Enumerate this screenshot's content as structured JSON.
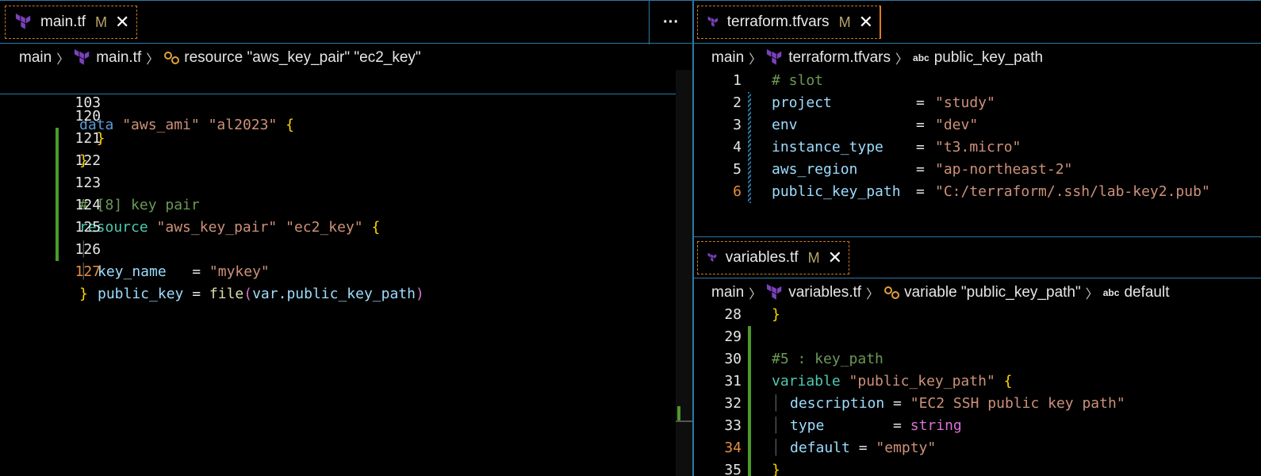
{
  "left": {
    "tab": {
      "label": "main.tf",
      "modified": "M",
      "close": "✕"
    },
    "more": "···",
    "breadcrumb": {
      "root": "main",
      "file": "main.tf",
      "symbol": "resource \"aws_key_pair\" \"ec2_key\""
    },
    "sticky": {
      "num": "103",
      "code": [
        "data",
        "\"aws_ami\"",
        "\"al2023\"",
        "{"
      ]
    },
    "lines": [
      {
        "num": "120",
        "text": "  }"
      },
      {
        "num": "121",
        "text": "}"
      },
      {
        "num": "122",
        "text": ""
      },
      {
        "num": "123",
        "text": "# [8] key pair"
      },
      {
        "num": "124",
        "text": "resource"
      },
      {
        "num": "125",
        "text": "key_name"
      },
      {
        "num": "126",
        "text": "public_key"
      },
      {
        "num": "127",
        "text": "}"
      }
    ],
    "l124": {
      "a": "\"aws_key_pair\"",
      "b": "\"ec2_key\""
    },
    "l125": {
      "eq": "   = ",
      "val": "\"mykey\""
    },
    "l126": {
      "eq": " = ",
      "fn": "file",
      "arg": "var.public_key_path"
    }
  },
  "right_top": {
    "tab": {
      "label": "terraform.tfvars",
      "modified": "M",
      "close": "✕"
    },
    "breadcrumb": {
      "root": "main",
      "file": "terraform.tfvars",
      "symbol": "public_key_path",
      "abc": "abc"
    },
    "lines": [
      {
        "num": "1",
        "key": "# slot",
        "val": ""
      },
      {
        "num": "2",
        "key": "project",
        "val": "\"study\""
      },
      {
        "num": "3",
        "key": "env",
        "val": "\"dev\""
      },
      {
        "num": "4",
        "key": "instance_type",
        "val": "\"t3.micro\""
      },
      {
        "num": "5",
        "key": "aws_region",
        "val": "\"ap-northeast-2\""
      },
      {
        "num": "6",
        "key": "public_key_path",
        "val": "\"C:/terraform/.ssh/lab-key2.pub\""
      }
    ]
  },
  "right_bottom": {
    "tab": {
      "label": "variables.tf",
      "modified": "M",
      "close": "✕"
    },
    "breadcrumb": {
      "root": "main",
      "file": "variables.tf",
      "symbol": "variable \"public_key_path\"",
      "leaf": "default",
      "abc": "abc"
    },
    "lines": [
      {
        "num": "28",
        "text": "}"
      },
      {
        "num": "29",
        "text": ""
      },
      {
        "num": "30",
        "text": "#5 : key_path"
      },
      {
        "num": "31",
        "text": "variable"
      },
      {
        "num": "32",
        "text": "description"
      },
      {
        "num": "33",
        "text": "type"
      },
      {
        "num": "34",
        "text": "default"
      },
      {
        "num": "35",
        "text": "}"
      }
    ],
    "l31": {
      "name": "\"public_key_path\""
    },
    "l32": {
      "eq": " = ",
      "val": "\"EC2 SSH public key path\""
    },
    "l33": {
      "eq": "        = ",
      "val": "string"
    },
    "l34": {
      "eq": " = ",
      "val": "\"empty\""
    }
  },
  "colors": {
    "accent": "#2b79a6",
    "modified_tab_border": "#c87b1f",
    "git_added": "#4c9a2a"
  }
}
